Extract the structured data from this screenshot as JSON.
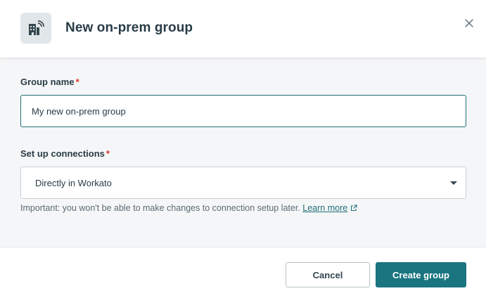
{
  "dialog": {
    "title": "New on-prem group",
    "header_icon": "building-signal-icon",
    "close_icon": "close-icon"
  },
  "form": {
    "group_name": {
      "label": "Group name",
      "required_marker": "*",
      "value": "My new on-prem group"
    },
    "connections": {
      "label": "Set up connections",
      "required_marker": "*",
      "selected": "Directly in Workato",
      "hint": "Important: you won't be able to make changes to connection setup later.",
      "learn_more": "Learn more",
      "link_icon": "external-link-icon"
    }
  },
  "footer": {
    "cancel_label": "Cancel",
    "create_label": "Create group"
  },
  "colors": {
    "primary": "#1a7580",
    "required": "#d9342b",
    "body_bg": "#f5f6f7"
  }
}
